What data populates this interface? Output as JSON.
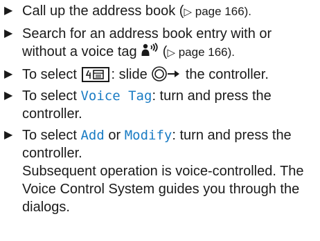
{
  "steps": [
    {
      "pre": "Call up the address book (",
      "ref_arrow": "▷",
      "ref": " page 166).",
      "post": ""
    },
    {
      "pre": "Search for an address book entry with or without a voice tag ",
      "mid": " (",
      "ref_arrow": "▷",
      "ref": " page 166)."
    },
    {
      "pre": "To select ",
      "mid": ": slide ",
      "post": " the controller."
    },
    {
      "pre": "To select ",
      "display": "Voice Tag",
      "post": ": turn and press the controller."
    },
    {
      "pre": "To select ",
      "display1": "Add",
      "mid": " or ",
      "display2": "Modify",
      "post": ": turn and press the controller.",
      "note": "Subsequent operation is voice-controlled. The Voice Control System guides you through the dialogs."
    }
  ],
  "bullet": "▶"
}
